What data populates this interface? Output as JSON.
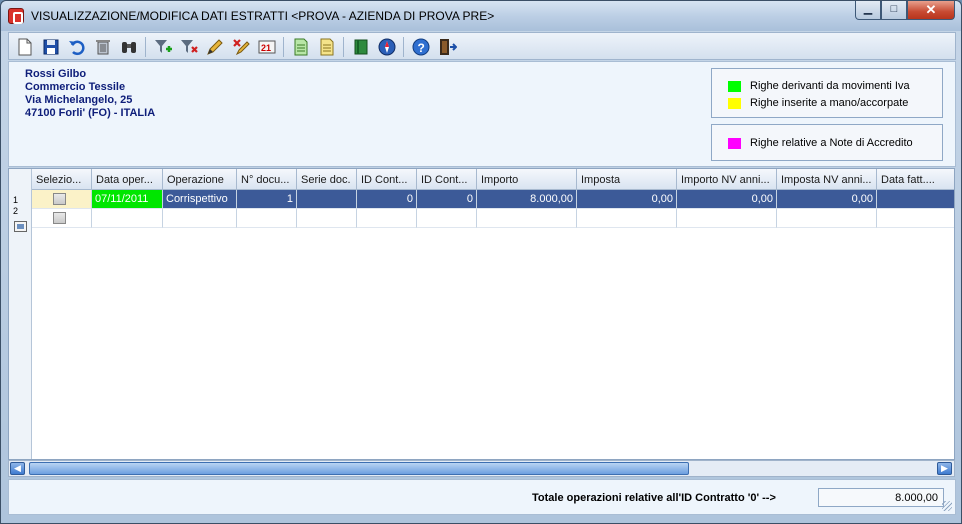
{
  "window": {
    "title": "VISUALIZZAZIONE/MODIFICA DATI ESTRATTI <PROVA - AZIENDA DI PROVA PRE>",
    "minimize_glyph": "▁",
    "maximize_glyph": "□",
    "close_glyph": "✕"
  },
  "toolbar": {
    "icons": [
      "new-document-icon",
      "save-disk-icon",
      "undo-icon",
      "trash-icon",
      "binoculars-icon",
      "filter-add-icon",
      "filter-remove-icon",
      "edit-pencil-icon",
      "clear-selection-icon",
      "renumber-icon",
      "green-sheet-icon",
      "yellow-sheet-icon",
      "book-icon",
      "compass-icon",
      "help-icon",
      "exit-door-icon"
    ]
  },
  "company": {
    "name": "Rossi Gilbo",
    "activity": "Commercio Tessile",
    "street": "Via Michelangelo, 25",
    "city": "47100 Forli' (FO) - ITALIA"
  },
  "legend": {
    "items": [
      {
        "label": "Righe derivanti da movimenti Iva",
        "color": "#00ff00"
      },
      {
        "label": "Righe inserite a mano/accorpate",
        "color": "#ffff00"
      },
      {
        "label": "Righe relative a Note di Accredito",
        "color": "#ff00ff"
      }
    ]
  },
  "grid": {
    "columns": [
      "Selezio...",
      "Data oper...",
      "Operazione",
      "N° docu...",
      "Serie doc.",
      "ID Cont...",
      "ID Cont...",
      "Importo",
      "Imposta",
      "Importo NV anni...",
      "Imposta NV anni...",
      "Data fatt...."
    ],
    "rows": [
      {
        "num": "1",
        "data": "07/11/2011",
        "operazione": "Corrispettivo",
        "n_doc": "1",
        "serie": "",
        "id1": "0",
        "id2": "0",
        "importo": "8.000,00",
        "imposta": "0,00",
        "imp_nv": "0,00",
        "imposta_nv": "0,00",
        "data_fatt": ""
      },
      {
        "num": "2",
        "data": "",
        "operazione": "",
        "n_doc": "",
        "serie": "",
        "id1": "",
        "id2": "",
        "importo": "",
        "imposta": "",
        "imp_nv": "",
        "imposta_nv": "",
        "data_fatt": ""
      }
    ],
    "highlight_color": "#00e600"
  },
  "scroll": {
    "left_glyph": "◀",
    "right_glyph": "▶"
  },
  "footer": {
    "total_label": "Totale operazioni relative all'ID Contratto '0' -->",
    "total_value": "8.000,00"
  }
}
